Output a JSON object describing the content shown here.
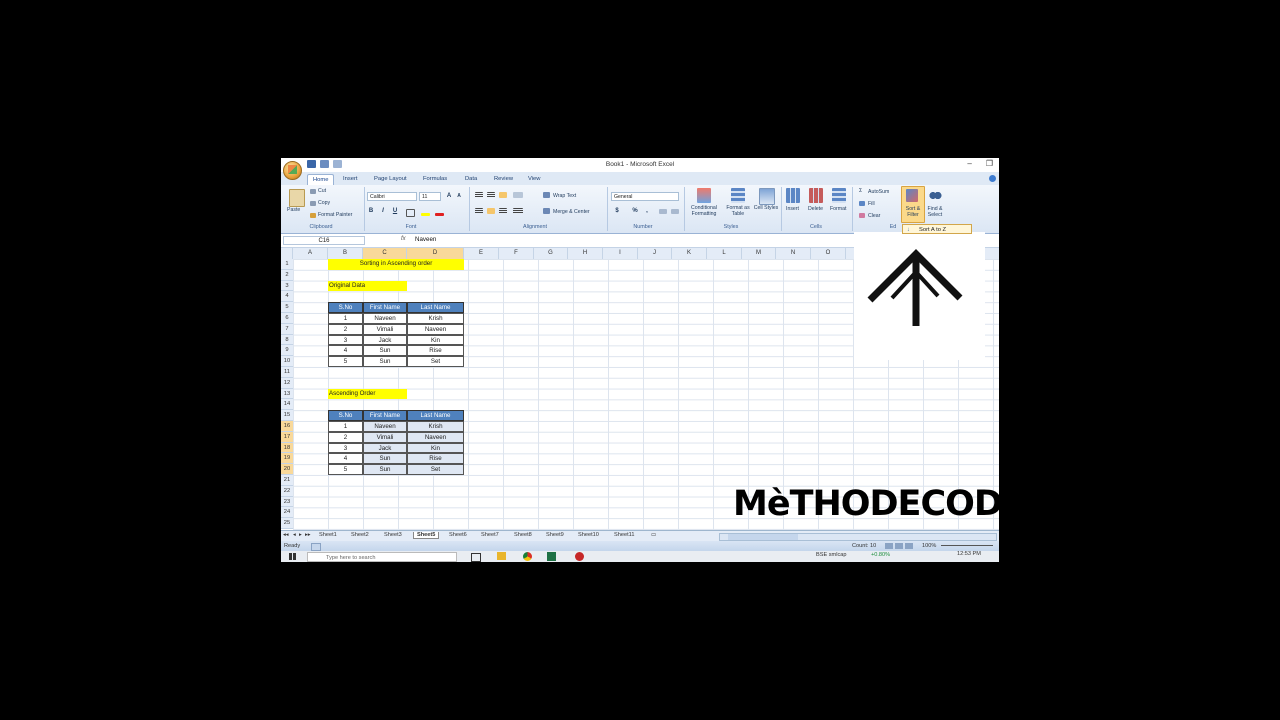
{
  "window": {
    "title": "Book1 - Microsoft Excel",
    "minimize": "–",
    "restore": "❐"
  },
  "tabs": [
    "Home",
    "Insert",
    "Page Layout",
    "Formulas",
    "Data",
    "Review",
    "View"
  ],
  "ribbon": {
    "clipboard": {
      "label": "Clipboard",
      "paste": "Paste",
      "cut": "Cut",
      "copy": "Copy",
      "format_painter": "Format Painter"
    },
    "font": {
      "label": "Font",
      "name": "Calibri",
      "size": "11",
      "bold": "B",
      "italic": "I",
      "underline": "U"
    },
    "alignment": {
      "label": "Alignment",
      "wrap_text": "Wrap Text",
      "merge_center": "Merge & Center"
    },
    "number": {
      "label": "Number",
      "format": "General",
      "currency": "$",
      "percent": "%",
      "comma": ","
    },
    "styles": {
      "label": "Styles",
      "conditional": "Conditional Formatting",
      "format_table": "Format as Table",
      "cell_styles": "Cell Styles"
    },
    "cells": {
      "label": "Cells",
      "insert": "Insert",
      "delete": "Delete",
      "format": "Format"
    },
    "editing": {
      "label": "Editing",
      "label_short": "Ed",
      "autosum": "AutoSum",
      "fill": "Fill",
      "clear": "Clear",
      "sort_filter": "Sort & Filter",
      "find_select": "Find & Select"
    }
  },
  "sort_popup": "Sort A to Z",
  "formula_bar": {
    "name_box": "C16",
    "fx": "fx",
    "value": "Naveen"
  },
  "columns": [
    "A",
    "B",
    "C",
    "D",
    "E",
    "F",
    "G",
    "H",
    "I",
    "J",
    "K",
    "L",
    "M",
    "N",
    "O"
  ],
  "rows": [
    "1",
    "2",
    "3",
    "4",
    "5",
    "6",
    "7",
    "8",
    "9",
    "10",
    "11",
    "12",
    "13",
    "14",
    "15",
    "16",
    "17",
    "18",
    "19",
    "20",
    "21",
    "22",
    "23",
    "24",
    "25"
  ],
  "sheet": {
    "title": "Sorting in Ascending order",
    "original_label": "Original Data",
    "ascending_label": "Ascending Order",
    "headers": [
      "S.No",
      "First Name",
      "Last Name"
    ],
    "original": [
      [
        "1",
        "Naveen",
        "Krish"
      ],
      [
        "2",
        "Vimali",
        "Naveen"
      ],
      [
        "3",
        "Jack",
        "Kin"
      ],
      [
        "4",
        "Sun",
        "Rise"
      ],
      [
        "5",
        "Sun",
        "Set"
      ]
    ],
    "ascending": [
      [
        "1",
        "Naveen",
        "Krish"
      ],
      [
        "2",
        "Vimali",
        "Naveen"
      ],
      [
        "3",
        "Jack",
        "Kin"
      ],
      [
        "4",
        "Sun",
        "Rise"
      ],
      [
        "5",
        "Sun",
        "Set"
      ]
    ]
  },
  "sheet_tabs": [
    "Sheet1",
    "Sheet2",
    "Sheet3",
    "Sheet5",
    "Sheet6",
    "Sheet7",
    "Sheet8",
    "Sheet9",
    "Sheet10",
    "Sheet11"
  ],
  "active_sheet": "Sheet5",
  "status": {
    "ready": "Ready",
    "count": "Count: 10",
    "zoom": "100%"
  },
  "taskbar": {
    "search_placeholder": "Type here to search",
    "weather": "BSE smlcap",
    "change": "+0.80%",
    "time": "12:53 PM"
  },
  "watermark": "MèTHODECODE"
}
